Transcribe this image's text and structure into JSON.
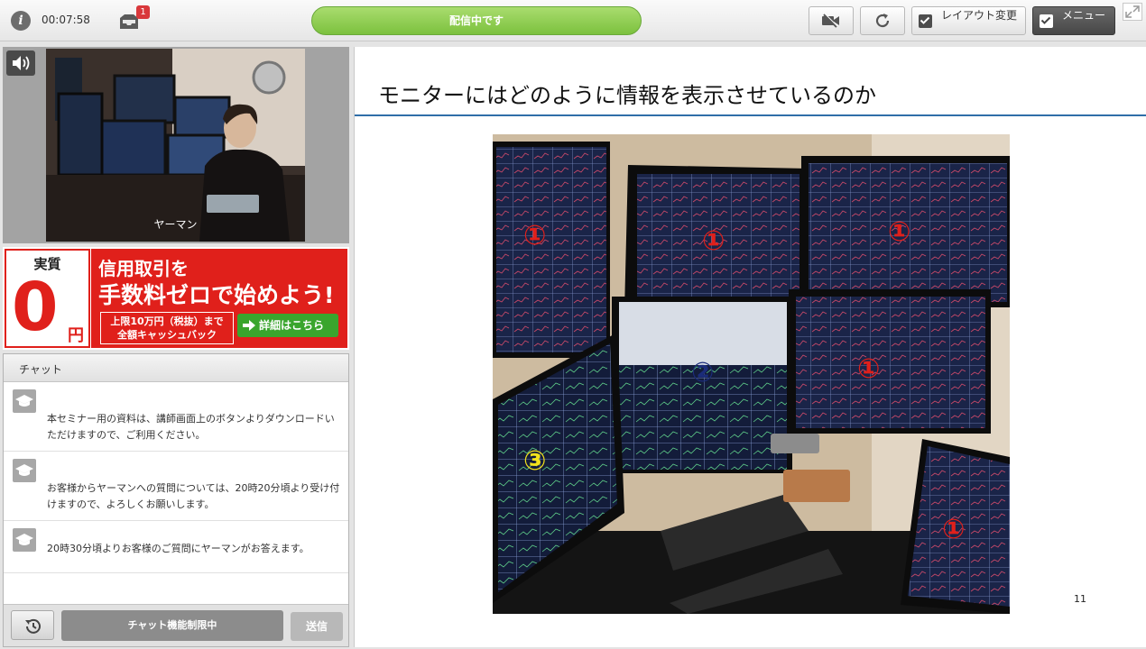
{
  "topbar": {
    "elapsed_time": "00:07:58",
    "notification_count": "1",
    "status_text": "配信中です",
    "layout_button_label": "レイアウト変更",
    "menu_button_label": "メニュー"
  },
  "video": {
    "presenter_name": "ヤーマン"
  },
  "ad": {
    "label_jissitsu": "実質",
    "zero": "0",
    "yen": "円",
    "line1": "信用取引を",
    "line2": "手数料ゼロで始めよう!",
    "small_line1": "上限10万円（税抜）まで",
    "small_line2": "全額キャッシュバック",
    "detail_button": "詳細はこちら"
  },
  "chat": {
    "title": "チャット",
    "messages": [
      {
        "text": "本セミナー用の資料は、講師画面上のボタンよりダウンロードいただけますので、ご利用ください。"
      },
      {
        "text": "お客様からヤーマンへの質問については、20時20分頃より受け付けますので、よろしくお願いします。"
      },
      {
        "text": "20時30分頃よりお客様のご質問にヤーマンがお答えます。"
      }
    ],
    "input_text": "チャット機能制限中",
    "send_label": "送信"
  },
  "slide": {
    "title": "モニターにはどのように情報を表示させているのか",
    "page_number": "11",
    "markers": [
      "①",
      "①",
      "①",
      "②",
      "①",
      "③",
      "①"
    ]
  },
  "colors": {
    "status_green": "#7cc13e",
    "ad_red": "#e0201b",
    "slide_rule_blue": "#2f6ea8",
    "marker_red": "#e0201b",
    "marker_blue": "#1b2c7a",
    "marker_yellow": "#f3e21c"
  },
  "icons": [
    "info-icon",
    "tray-icon",
    "camera-off-icon",
    "refresh-icon",
    "checkbox-icon",
    "expand-icon",
    "speaker-icon",
    "graduation-cap-icon",
    "history-icon",
    "arrow-right-icon"
  ]
}
